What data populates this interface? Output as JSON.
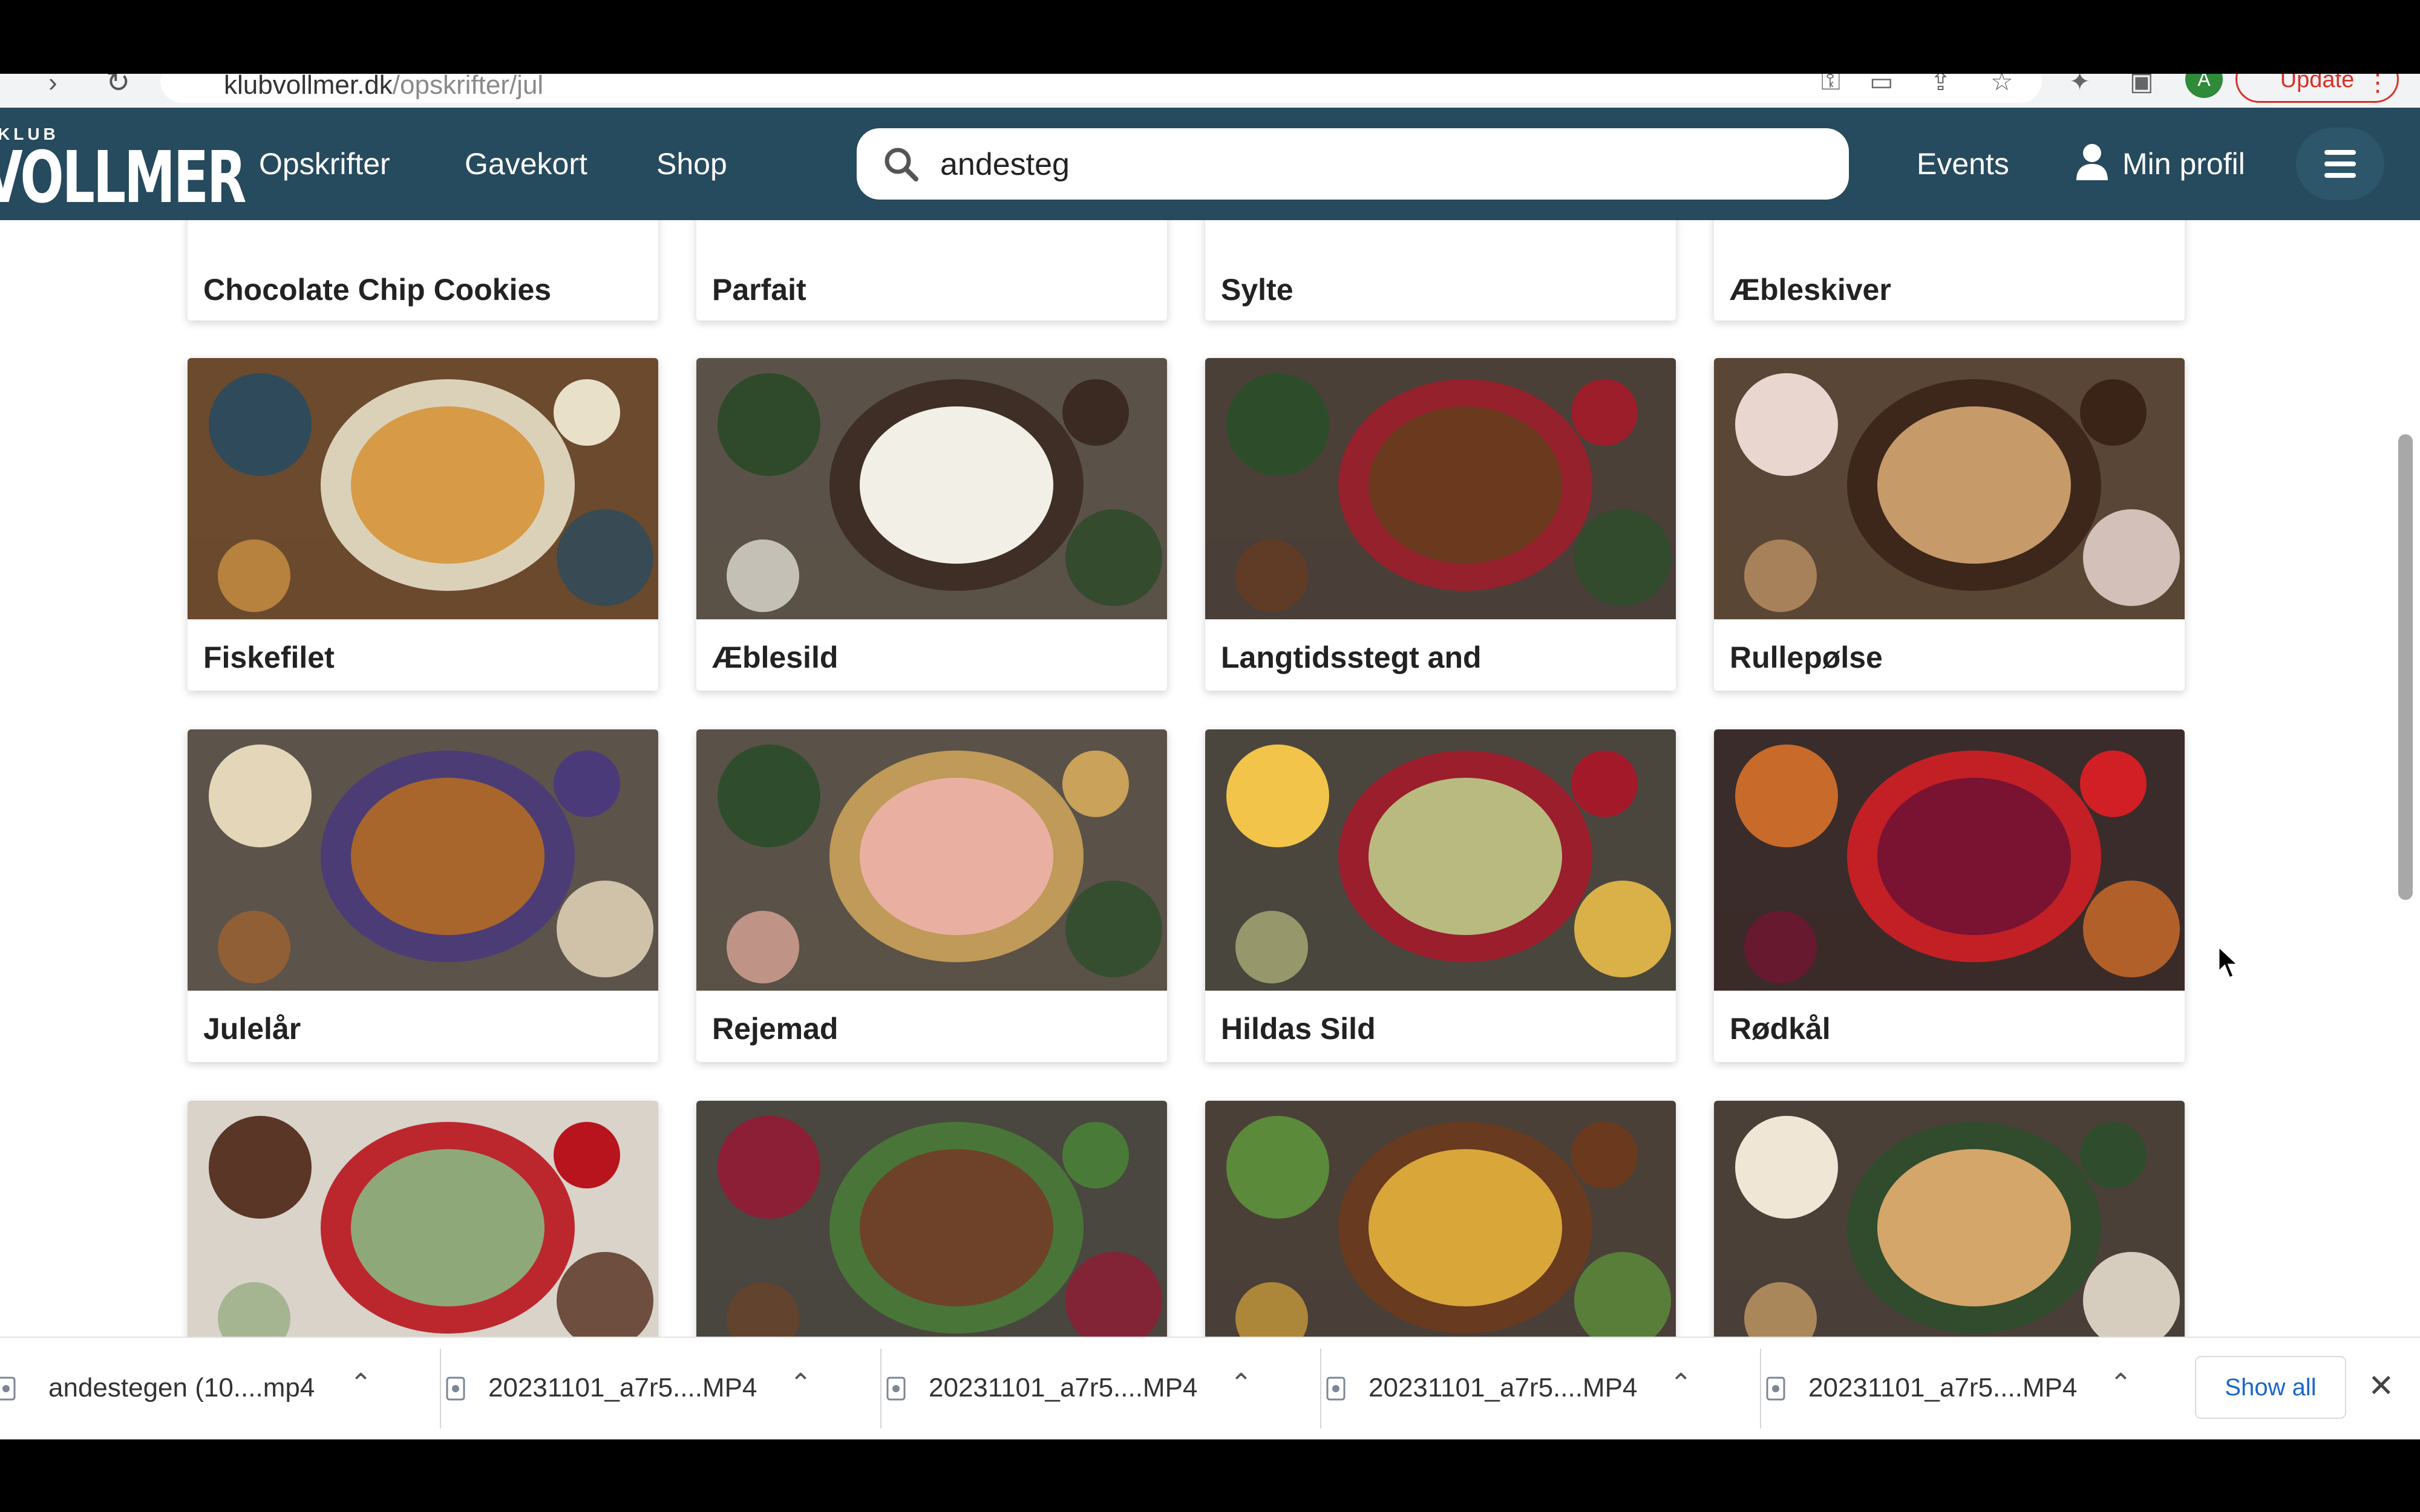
{
  "browser": {
    "url_domain": "klubvollmer.dk",
    "url_path": "/opskrifter/jul",
    "update_label": "Update",
    "profile_initial": "A"
  },
  "site": {
    "logo_small": "KLUB",
    "logo_main": "VOLLMER",
    "nav": [
      "Opskrifter",
      "Gavekort",
      "Shop"
    ],
    "search": {
      "value": "andesteg",
      "placeholder": ""
    },
    "events_label": "Events",
    "profile_label": "Min profil"
  },
  "recipes_partial": [
    {
      "title": "Chocolate Chip Cookies"
    },
    {
      "title": "Parfait"
    },
    {
      "title": "Sylte"
    },
    {
      "title": "Æbleskiver"
    }
  ],
  "recipes": [
    {
      "title": "Fiskefilet",
      "image": "fish-fillet-photo",
      "colors": [
        "#6b4a2d",
        "#d79a46",
        "#2f4a5a",
        "#e8e0c8"
      ]
    },
    {
      "title": "Æblesild",
      "image": "apple-herring-photo",
      "colors": [
        "#5a5248",
        "#f1efe6",
        "#2e4a2a",
        "#3b2a22"
      ]
    },
    {
      "title": "Langtidsstegt and",
      "image": "slow-roasted-duck-photo",
      "colors": [
        "#4a4038",
        "#6b3a1e",
        "#2d4d2a",
        "#9c1e2a"
      ]
    },
    {
      "title": "Rullepølse",
      "image": "rolled-pork-photo",
      "colors": [
        "#5a4636",
        "#c79a6a",
        "#e9d6cf",
        "#3a2418"
      ]
    },
    {
      "title": "Julelår",
      "image": "christmas-leg-photo",
      "colors": [
        "#5c534b",
        "#a8652c",
        "#e4d6b8",
        "#4a3a7a"
      ]
    },
    {
      "title": "Rejemad",
      "image": "shrimp-sandwich-photo",
      "colors": [
        "#5a5248",
        "#e9b0a2",
        "#2f4d2c",
        "#caa25a"
      ]
    },
    {
      "title": "Hildas Sild",
      "image": "hildas-herring-photo",
      "colors": [
        "#4a463e",
        "#b8ba80",
        "#f2c44a",
        "#a3192a"
      ]
    },
    {
      "title": "Rødkål",
      "image": "red-cabbage-photo",
      "colors": [
        "#3a2c2a",
        "#7a1232",
        "#c86a2a",
        "#d21f25"
      ]
    }
  ],
  "recipes_bottom": [
    {
      "image": "spinach-dish-photo",
      "colors": [
        "#d9d3ca",
        "#8fa87a",
        "#5a3626",
        "#b8141d"
      ]
    },
    {
      "image": "meatballs-photo",
      "colors": [
        "#4a4640",
        "#6e4228",
        "#8c1f35",
        "#4a7a38"
      ]
    },
    {
      "image": "duck-potatoes-photo",
      "colors": [
        "#4a4038",
        "#d9a63a",
        "#5b8a3a",
        "#6b3a1e"
      ]
    },
    {
      "image": "puff-pastry-photo",
      "colors": [
        "#4a4038",
        "#d4a66a",
        "#efe6d6",
        "#2f4d2c"
      ]
    }
  ],
  "downloads": {
    "items": [
      "andestegen (10....mp4",
      "20231101_a7r5....MP4",
      "20231101_a7r5....MP4",
      "20231101_a7r5....MP4",
      "20231101_a7r5....MP4"
    ],
    "show_all": "Show all"
  }
}
